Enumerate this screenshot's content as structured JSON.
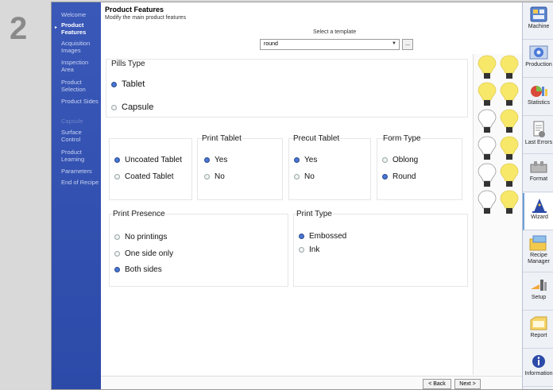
{
  "step_number": "2",
  "nav": {
    "items": [
      {
        "label": "Welcome",
        "state": "normal"
      },
      {
        "label": "Product Features",
        "state": "active"
      },
      {
        "label": "Acquisition Images",
        "state": "normal"
      },
      {
        "label": "Inspection Area",
        "state": "normal"
      },
      {
        "label": "Product Selection",
        "state": "normal"
      },
      {
        "label": "Product Sides",
        "state": "normal"
      },
      {
        "label": "Capsule",
        "state": "disabled"
      },
      {
        "label": "Surface Control",
        "state": "normal"
      },
      {
        "label": "Product Learning",
        "state": "normal"
      },
      {
        "label": "Parameters",
        "state": "normal"
      },
      {
        "label": "End of Recipe",
        "state": "normal"
      }
    ]
  },
  "header": {
    "title": "Product Features",
    "subtitle": "Modify the main product features"
  },
  "template": {
    "label": "Select a template",
    "value": "round",
    "browse_label": "..."
  },
  "pills_type": {
    "title": "Pills Type",
    "options": [
      {
        "label": "Tablet",
        "checked": true
      },
      {
        "label": "Capsule",
        "checked": false
      }
    ]
  },
  "coating": {
    "options": [
      {
        "label": "Uncoated Tablet",
        "checked": true
      },
      {
        "label": "Coated Tablet",
        "checked": false
      }
    ]
  },
  "print_tablet": {
    "title": "Print Tablet",
    "options": [
      {
        "label": "Yes",
        "checked": true
      },
      {
        "label": "No",
        "checked": false
      }
    ]
  },
  "precut_tablet": {
    "title": "Precut Tablet",
    "options": [
      {
        "label": "Yes",
        "checked": true
      },
      {
        "label": "No",
        "checked": false
      }
    ]
  },
  "form_type": {
    "title": "Form Type",
    "options": [
      {
        "label": "Oblong",
        "checked": false
      },
      {
        "label": "Round",
        "checked": true
      }
    ]
  },
  "print_presence": {
    "title": "Print Presence",
    "options": [
      {
        "label": "No printings",
        "checked": false
      },
      {
        "label": "One side only",
        "checked": false
      },
      {
        "label": "Both sides",
        "checked": true
      }
    ]
  },
  "print_type": {
    "title": "Print Type",
    "options": [
      {
        "label": "Embossed",
        "checked": true
      },
      {
        "label": "Ink",
        "checked": false
      }
    ]
  },
  "bulbs": {
    "rows": [
      [
        "on",
        "on"
      ],
      [
        "on",
        "on"
      ],
      [
        "off",
        "on"
      ],
      [
        "off",
        "on"
      ],
      [
        "off",
        "on"
      ],
      [
        "off",
        "on"
      ]
    ],
    "on_color": "#f7e86a",
    "off_color": "#ffffff"
  },
  "footer": {
    "back_label": "< Back",
    "next_label": "Next >"
  },
  "toolbar": {
    "items": [
      {
        "label": "Machine",
        "icon": "machine-icon"
      },
      {
        "label": "Production",
        "icon": "production-icon"
      },
      {
        "label": "Statistics",
        "icon": "statistics-icon"
      },
      {
        "label": "Last Errors",
        "icon": "last-errors-icon"
      },
      {
        "label": "Format",
        "icon": "format-icon"
      },
      {
        "label": "Wizard",
        "icon": "wizard-icon",
        "active": true
      },
      {
        "label": "Recipe Manager",
        "icon": "recipe-manager-icon"
      },
      {
        "label": "Setup",
        "icon": "setup-icon"
      },
      {
        "label": "Report",
        "icon": "report-icon"
      },
      {
        "label": "Information",
        "icon": "information-icon"
      }
    ]
  },
  "colors": {
    "nav_bg": "#3450b0",
    "radio_checked": "#3a5fb0",
    "accent": "#6fa0d8"
  }
}
